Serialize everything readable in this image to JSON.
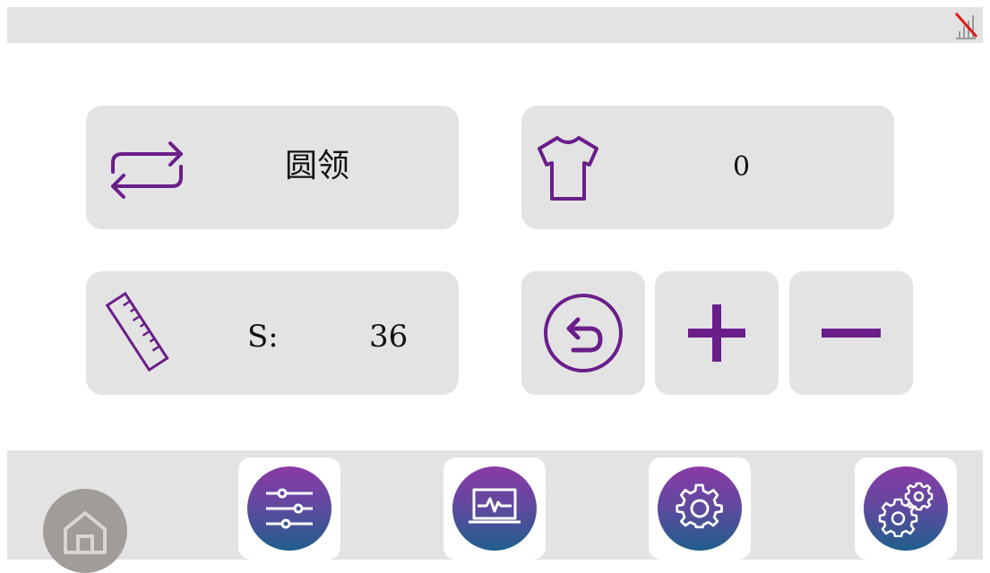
{
  "collar": {
    "label": "圆领"
  },
  "count": {
    "value": "0"
  },
  "size": {
    "label": "S:",
    "value": "36"
  },
  "icons": {
    "signal": "signal-off-icon",
    "collar": "repeat-icon",
    "shirt": "t-shirt-icon",
    "size": "ruler-icon",
    "reset": "undo-icon",
    "plus": "plus-icon",
    "minus": "minus-icon",
    "nav": [
      "home-icon",
      "sliders-icon",
      "monitor-icon",
      "gear-icon",
      "gears-icon"
    ]
  },
  "colors": {
    "accent": "#6a1e8a",
    "panel": "#e3e3e3",
    "home": "#a09c97"
  }
}
